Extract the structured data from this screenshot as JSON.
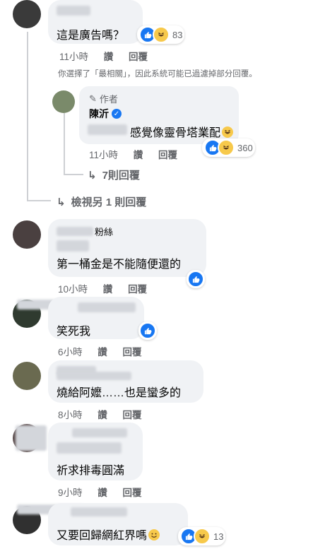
{
  "comments": [
    {
      "text": "這是廣告嗎？",
      "reaction_count": "83",
      "time": "11小時",
      "reply_label": "讚",
      "reply_button": "回覆"
    },
    {
      "text": "第一桶金是不能隨便還的",
      "name_suffix": "粉絲",
      "time": "10小時",
      "reply_label": "讚",
      "reply_button": "回覆"
    },
    {
      "text": "笑死我",
      "time": "6小時",
      "reply_label": "讚",
      "reply_button": "回覆"
    },
    {
      "text": "燒給阿嬤……也是蠻多的",
      "time": "8小時",
      "reply_label": "讚",
      "reply_button": "回覆"
    },
    {
      "text": "祈求排毒圓滿",
      "time": "9小時",
      "reply_label": "讚",
      "reply_button": "回覆"
    },
    {
      "text": "又要回歸網紅界嗎",
      "reaction_count": "13"
    }
  ],
  "filter_note": "你選擇了「最相關」，因此系統可能已過濾掉部分回覆。",
  "author_reply": {
    "badge": "作者",
    "name": "陳沂",
    "text": "感覺像靈骨塔業配",
    "reaction_count": "360",
    "time": "11小時",
    "like_label": "讚",
    "reply_button": "回覆"
  },
  "more_replies": "7則回覆",
  "view_more": "檢視另 1 則回覆",
  "icons": {
    "like": "like-icon",
    "haha": "haha-icon",
    "reply_arrow": "reply-arrow-icon",
    "verified": "verified-badge-icon",
    "pencil": "pencil-icon"
  },
  "colors": {
    "like": "#1877f2",
    "haha": "#f7c94b",
    "muted": "#65676b",
    "bubble": "#f0f2f5"
  }
}
